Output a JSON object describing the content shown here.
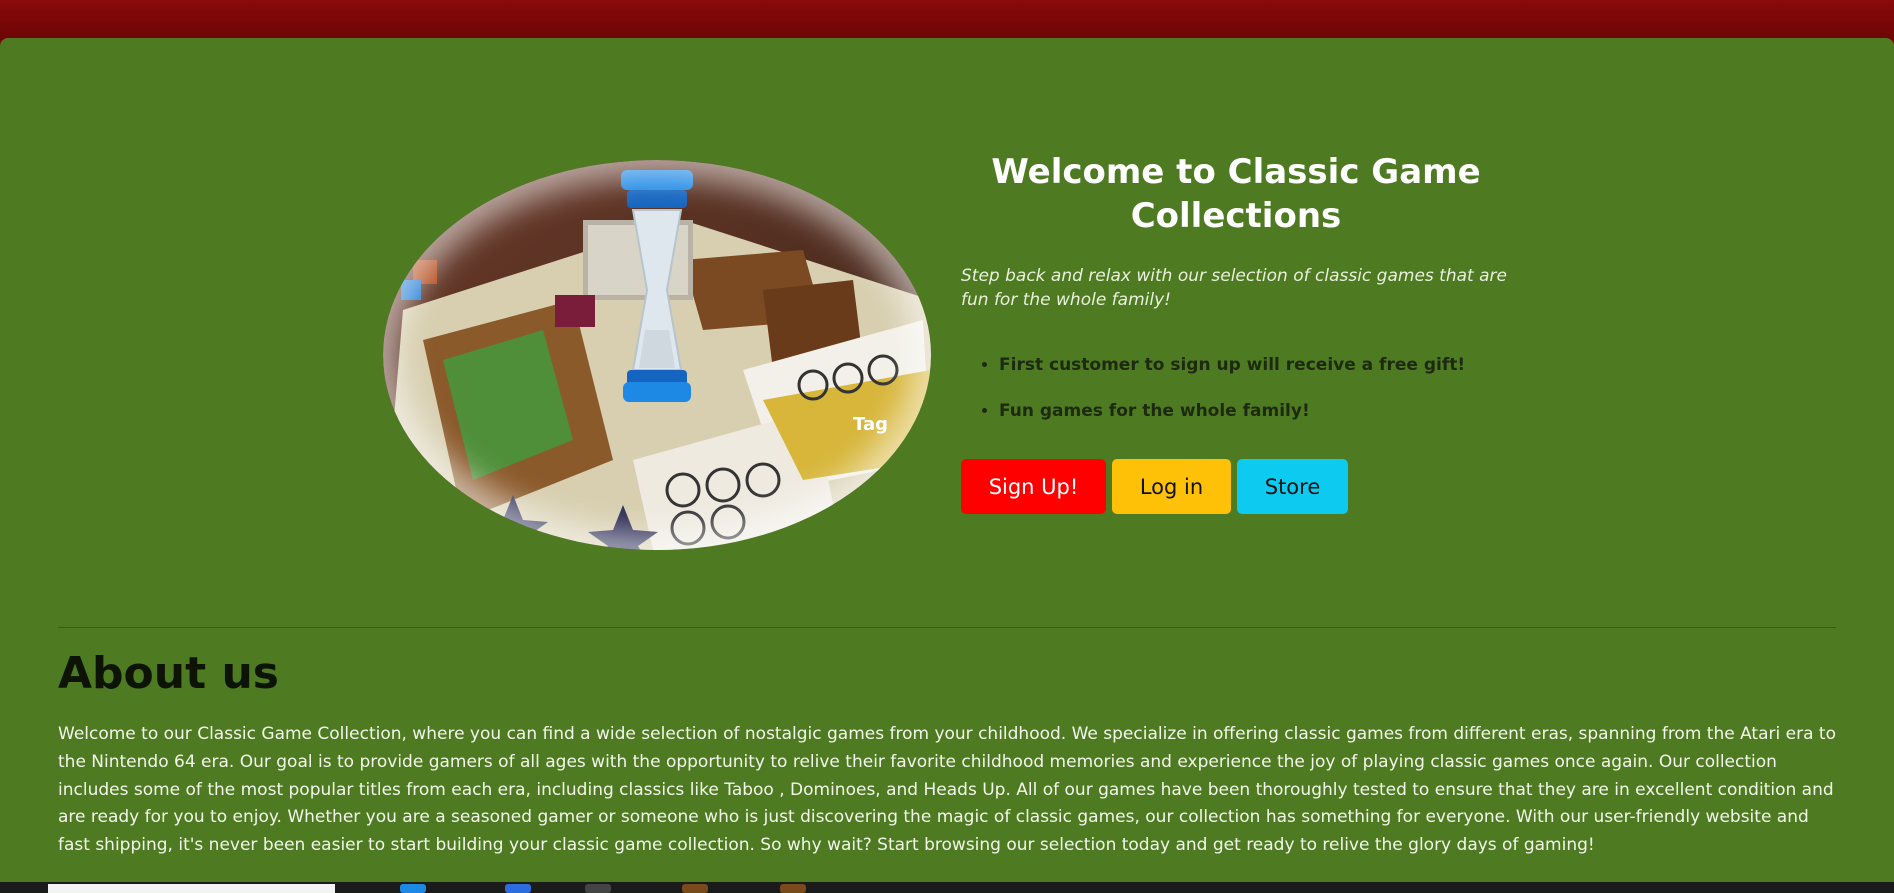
{
  "hero": {
    "title": "Welcome to Classic Game Collections",
    "subtitle": "Step back and relax with our selection of classic games that are fun for the whole family!",
    "bullets": [
      "First customer to sign up will receive a free gift!",
      "Fun games for the whole family!"
    ],
    "image_label": "Tag"
  },
  "buttons": {
    "signup": "Sign Up!",
    "login": "Log in",
    "store": "Store"
  },
  "about": {
    "title": "About us",
    "body": "Welcome to our Classic Game Collection, where you can find a wide selection of nostalgic games from your childhood. We specialize in offering classic games from different eras, spanning from the Atari era to the Nintendo 64 era. Our goal is to provide gamers of all ages with the opportunity to relive their favorite childhood memories and experience the joy of playing classic games once again. Our collection includes some of the most popular titles from each era, including classics like Taboo , Dominoes, and Heads Up. All of our games have been thoroughly tested to ensure that they are in excellent condition and are ready for you to enjoy. Whether you are a seasoned gamer or someone who is just discovering the magic of classic games, our collection has something for everyone. With our user-friendly website and fast shipping, it's never been easier to start building your classic game collection. So why wait? Start browsing our selection today and get ready to relive the glory days of gaming!"
  },
  "colors": {
    "top_bar": "#7a0707",
    "main_bg": "#4e7a22",
    "signup": "#ff0000",
    "login": "#ffc107",
    "store": "#0dcaf0"
  },
  "taskbar": {
    "icons": [
      "taskbar-app-icon",
      "taskbar-app-icon",
      "taskbar-app-icon",
      "taskbar-app-icon",
      "taskbar-app-icon"
    ]
  }
}
